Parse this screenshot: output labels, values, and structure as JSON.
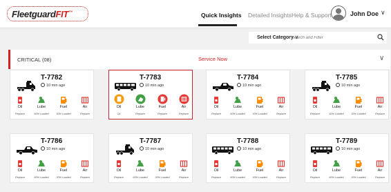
{
  "header": {
    "logo_main": "Fleetguard",
    "logo_fit": "FIT",
    "logo_tm": "™",
    "nav": [
      "Quick Insights",
      "Detailed Insights",
      "Help & Support"
    ],
    "user_name": "John Doe"
  },
  "filter": {
    "select_label": "Select Category",
    "search_placeholder": "Search and Filter"
  },
  "critical": {
    "label": "CRITICAL (08)",
    "action": "Service Now"
  },
  "icon_labels": [
    "Oil",
    "Lube",
    "Fuel",
    "Air"
  ],
  "trucks": [
    {
      "id": "T-7782",
      "ago": "10 min ago",
      "vehicle": "semi-truck",
      "status": [
        "Replace",
        "60% Loaded",
        "30% Loaded",
        "Replace"
      ]
    },
    {
      "id": "T-7783",
      "ago": "10 min ago",
      "vehicle": "bus",
      "status": [
        "Oil",
        "Replace",
        "Replace",
        "Replace"
      ]
    },
    {
      "id": "T-7784",
      "ago": "10 min ago",
      "vehicle": "pickup",
      "status": [
        "Replace",
        "60% Loaded",
        "30% Loaded",
        "Replace"
      ]
    },
    {
      "id": "T-7785",
      "ago": "10 min ago",
      "vehicle": "semi-truck",
      "status": [
        "Replace",
        "60% Loaded",
        "30% Loaded",
        "Replace"
      ]
    },
    {
      "id": "T-7786",
      "ago": "10 min ago",
      "vehicle": "pickup",
      "status": [
        "Replace",
        "60% Loaded",
        "30% Loaded",
        "Replace"
      ]
    },
    {
      "id": "T-7787",
      "ago": "10 min ago",
      "vehicle": "semi-truck",
      "status": [
        "Replace",
        "60% Loaded",
        "30% Loaded",
        "Replace"
      ]
    },
    {
      "id": "T-7788",
      "ago": "10 min ago",
      "vehicle": "bus",
      "status": [
        "Replace",
        "60% Loaded",
        "30% Loaded",
        "Replace"
      ]
    },
    {
      "id": "T-7789",
      "ago": "10 min ago",
      "vehicle": "bus",
      "status": [
        "Replace",
        "60% Loaded",
        "30% Loaded",
        "Replace"
      ]
    }
  ],
  "colors": {
    "accent_red": "#d21f1f",
    "oil_red": "#e53935",
    "lube_green": "#43a047",
    "fuel_orange": "#fb8c00",
    "air_red": "#e53935",
    "oil_orange_selected": "#f39c12"
  }
}
